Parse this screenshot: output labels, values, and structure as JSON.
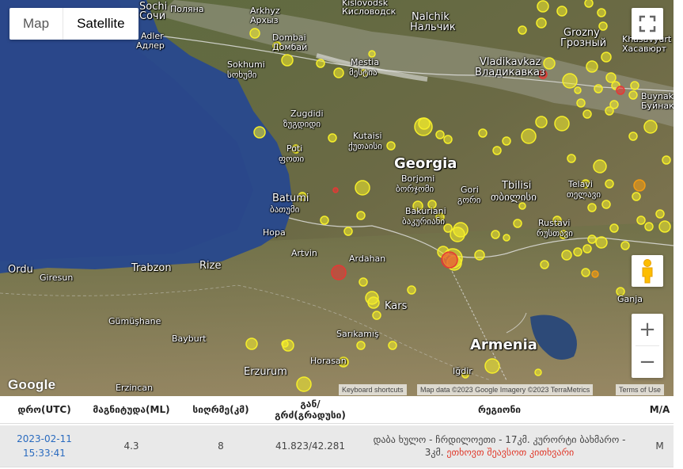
{
  "map_type": {
    "map_label": "Map",
    "satellite_label": "Satellite",
    "selected": "Satellite"
  },
  "labels": {
    "sochi": "Sochi",
    "sochi_geo": "Сочи",
    "polyana": "Поляна",
    "arkhyz": "Arkhyz",
    "arkhyz_ru": "Архыз",
    "kislovodsk": "Kislovodsk",
    "kislovodsk_ru": "Кисловодск",
    "nalchik": "Nalchik",
    "nalchik_ru": "Нальчик",
    "grozny": "Grozny",
    "grozny_ru": "Грозный",
    "khasavyurt": "Khasavyurt",
    "khasavyurt_ru": "Хасавюрт",
    "adler": "Adler",
    "adler_ru": "Адлер",
    "dombai": "Dombai",
    "dombai_ru": "Домбай",
    "vladikavkaz": "Vladikavkaz",
    "vladikavkaz_ru": "Владикавказ",
    "mestia": "Mestia",
    "mestia_ka": "მესტია",
    "sokhumi": "Sokhumi",
    "sokhumi_ka": "სოხუმი",
    "buynak": "Buynak",
    "buynak_ru": "Буйнак",
    "zugdidi": "Zugdidi",
    "zugdidi_ka": "ზუგდიდი",
    "kutaisi": "Kutaisi",
    "kutaisi_ka": "ქუთაისი",
    "poti": "Poti",
    "poti_ka": "ფოთი",
    "georgia": "Georgia",
    "borjomi": "Borjomi",
    "borjomi_ka": "ბორჯომი",
    "gori": "Gori",
    "gori_ka": "გორი",
    "tbilisi": "Tbilisi",
    "tbilisi_ka": "თბილისი",
    "telavi": "Telavi",
    "telavi_ka": "თელავი",
    "batumi": "Batumi",
    "batumi_ka": "ბათუმი",
    "bakuriani": "Bakuriani",
    "bakuriani_ka": "ბაკურიანი",
    "rustavi": "Rustavi",
    "rustavi_ka": "რუსთავი",
    "hopa": "Hopa",
    "artvin": "Artvin",
    "ardahan": "Ardahan",
    "ordu": "Ordu",
    "giresun": "Giresun",
    "trabzon": "Trabzon",
    "rize": "Rize",
    "ganja": "Ganja",
    "kars": "Kars",
    "gumushane": "Gümüşhane",
    "bayburt": "Bayburt",
    "sarikamis": "Sarıkamış",
    "armenia": "Armenia",
    "erzurum": "Erzurum",
    "horasan": "Horasan",
    "igdir": "Iğdir",
    "erzincan": "Erzincan"
  },
  "google_logo": "Google",
  "attribution": {
    "shortcuts": "Keyboard shortcuts",
    "data": "Map data ©2023 Google Imagery ©2023 TerraMetrics",
    "terms": "Terms of Use"
  },
  "controls": {
    "zoom_in": "+",
    "zoom_out": "−"
  },
  "table": {
    "headers": [
      "დრო(UTC)",
      "მაგნიტუდა(ML)",
      "სიღრმე(კმ)",
      "გან/გრძ(გრადუსი)",
      "რეგიონი",
      "M/A"
    ],
    "rows": [
      {
        "date": "2023-02-11",
        "time": "15:33:41",
        "magnitude": "4.3",
        "depth": "8",
        "coords": "41.823/42.281",
        "region_line1": "დაბა ხულო - ჩრდილოეთი - 17კმ. კურორტი ბახმარო -",
        "region_line2_prefix": "3კმ.",
        "region_link": "ეთხოვთ შეავსოთ კითხვარი",
        "type": "M"
      }
    ]
  },
  "colors": {
    "quake_yellow": "#f5ee2a",
    "quake_red": "#e53935",
    "quake_orange": "#f39c12",
    "sea": "#2b4a8a"
  }
}
